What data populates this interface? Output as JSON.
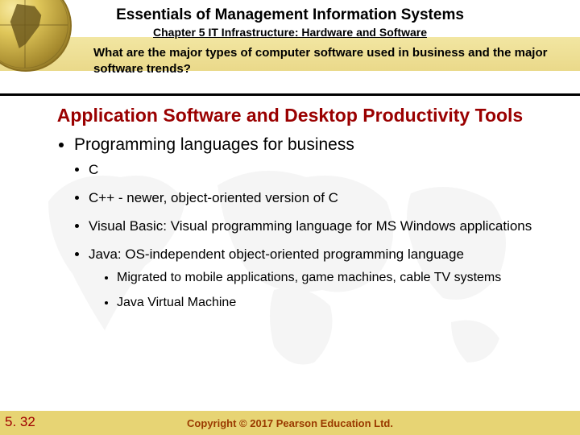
{
  "header": {
    "title": "Essentials of Management Information Systems",
    "chapter": "Chapter 5 IT Infrastructure: Hardware and Software",
    "subquestion": "What are the major types of computer software used in business and the major software trends?"
  },
  "section_title": "Application Software and Desktop Productivity Tools",
  "bullets": {
    "main": "Programming languages for business",
    "items": [
      "C",
      "C++ - newer, object-oriented version of C",
      "Visual Basic: Visual programming language for MS Windows applications",
      "Java: OS-independent object-oriented programming language"
    ],
    "java_sub": [
      "Migrated to mobile applications, game machines, cable TV systems",
      "Java Virtual Machine"
    ]
  },
  "footer": {
    "page": "5. 32",
    "copyright": "Copyright © 2017 Pearson Education Ltd."
  }
}
